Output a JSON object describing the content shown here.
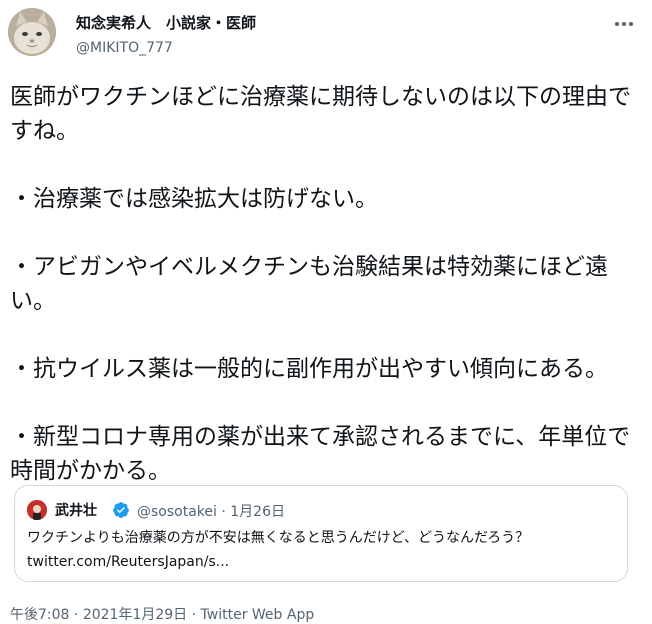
{
  "author": {
    "name": "知念実希人　小説家・医師",
    "handle": "@MIKITO_777",
    "avatar_icon": "cat-avatar-icon"
  },
  "more_icon": "more-options-icon",
  "tweet": {
    "lines": [
      "医師がワクチンほどに治療薬に期待しないのは以下の理由ですね。",
      "",
      "・治療薬では感染拡大は防げない。",
      "",
      "・アビガンやイベルメクチンも治験結果は特効薬にほど遠い。",
      "",
      "・抗ウイルス薬は一般的に副作用が出やすい傾向にある。",
      "",
      "・新型コロナ専用の薬が出来て承認されるまでに、年単位で時間がかかる。"
    ]
  },
  "quote": {
    "name": "武井壮",
    "verified_icon": "verified-badge-icon",
    "meta": "@sosotakei · 1月26日",
    "text": "ワクチンよりも治療薬の方が不安は無くなると思うんだけど、どうなんだろう？",
    "link": "twitter.com/ReutersJapan/s..."
  },
  "footer": {
    "time": "午後7:08",
    "sep1": " · ",
    "date": "2021年1月29日",
    "sep2": " · ",
    "app": "Twitter Web App"
  },
  "colors": {
    "text": "#0f1419",
    "secondary": "#536471",
    "border": "#cfd9de",
    "verified": "#1d9bf0"
  }
}
